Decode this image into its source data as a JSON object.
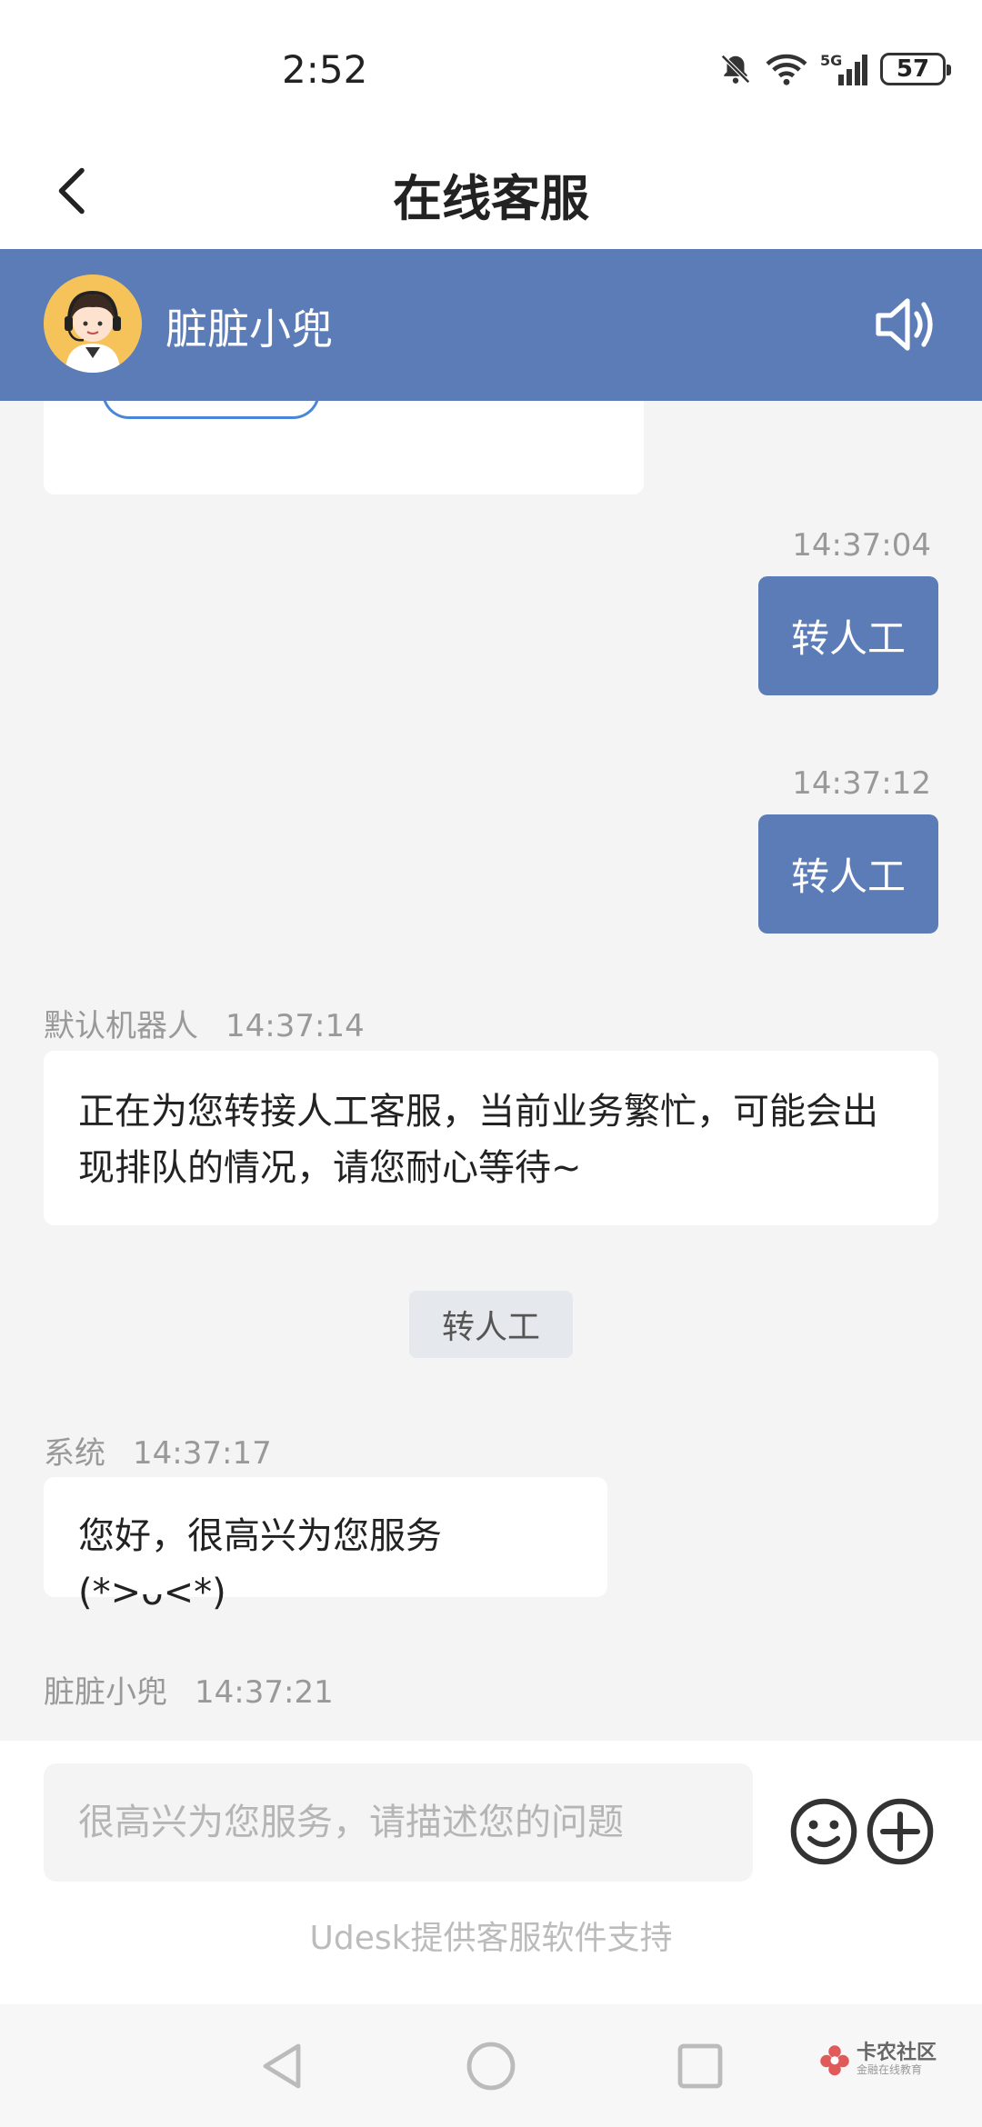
{
  "status_bar": {
    "time": "2:52",
    "battery": "57",
    "network": "5G"
  },
  "nav": {
    "title": "在线客服"
  },
  "agent_bar": {
    "name": "脏脏小兜"
  },
  "messages": [
    {
      "type": "outgoing",
      "time": "14:37:04",
      "text": "转人工"
    },
    {
      "type": "outgoing",
      "time": "14:37:12",
      "text": "转人工"
    },
    {
      "type": "incoming",
      "sender": "默认机器人",
      "time": "14:37:14",
      "text": "正在为您转接人工客服，当前业务繁忙，可能会出现排队的情况，请您耐心等待~"
    },
    {
      "type": "system",
      "text": "转人工"
    },
    {
      "type": "incoming",
      "sender": "系统",
      "time": "14:37:17",
      "text": "您好，很高兴为您服务(*>ᴗ<*)"
    },
    {
      "type": "incoming",
      "sender": "脏脏小兜",
      "time": "14:37:21",
      "text": ""
    }
  ],
  "input": {
    "placeholder": "很高兴为您服务，请描述您的问题",
    "value": ""
  },
  "footer": {
    "powered_by": "Udesk提供客服软件支持"
  },
  "watermark": {
    "main": "卡农社区",
    "sub": "金融在线教育"
  },
  "colors": {
    "accent": "#5c7cb8",
    "background": "#f4f4f4"
  }
}
